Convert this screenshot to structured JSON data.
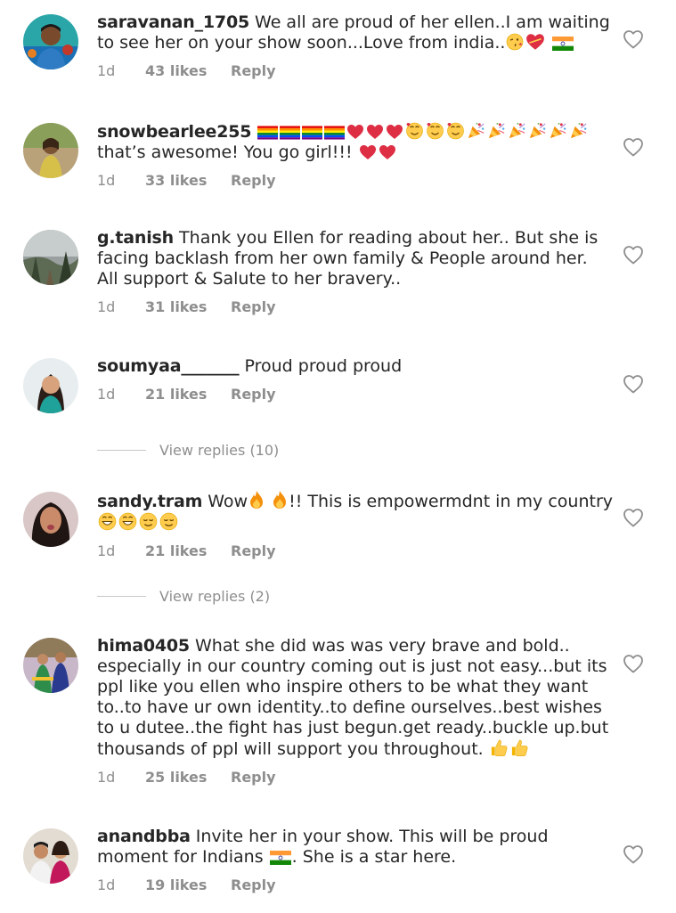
{
  "comments": [
    {
      "username": "saravanan_1705",
      "text_before": "We all are proud of her ellen..I am waiting to see her on your show soon...Love from india..",
      "emojis": [
        "kiss-face",
        "heart-ribbon",
        "india-flag"
      ],
      "time": "1d",
      "likes": "43 likes",
      "reply": "Reply"
    },
    {
      "username": "snowbearlee255",
      "head_emojis": [
        "rainbow-flag",
        "rainbow-flag",
        "rainbow-flag",
        "rainbow-flag",
        "red-heart",
        "red-heart",
        "red-heart",
        "smiling-face-with-hearts",
        "smiling-face-with-hearts",
        "smiling-face-with-hearts",
        "party-popper",
        "party-popper",
        "party-popper",
        "party-popper",
        "party-popper",
        "party-popper"
      ],
      "text": "that’s awesome! You go girl!!!",
      "tail_emojis": [
        "red-heart",
        "red-heart"
      ],
      "time": "1d",
      "likes": "33 likes",
      "reply": "Reply"
    },
    {
      "username": "g.tanish",
      "text": "Thank you Ellen for reading about her.. But she is facing backlash from her own family & People around her.  All support & Salute to her bravery..",
      "time": "1d",
      "likes": "31 likes",
      "reply": "Reply"
    },
    {
      "username": "soumyaa_______",
      "text": "Proud proud proud",
      "time": "1d",
      "likes": "21 likes",
      "reply": "Reply",
      "view_replies": "View replies (10)"
    },
    {
      "username": "sandy.tram",
      "text_a": "Wow",
      "text_b": "!! This is empowermdnt in my country",
      "emojis_a": [
        "fire",
        "fire"
      ],
      "emojis_b": [
        "grinning-face",
        "grinning-face",
        "relieved-face",
        "relieved-face"
      ],
      "time": "1d",
      "likes": "21 likes",
      "reply": "Reply",
      "view_replies": "View replies (2)"
    },
    {
      "username": "hima0405",
      "text": "What she did was was very brave and bold.. especially in our country coming out is just not easy...but its ppl like you ellen who inspire others to be what they want to..to have ur own identity..to define ourselves..best wishes to u dutee..the fight has just begun.get ready..buckle up.but thousands of ppl will support you throughout.",
      "emojis": [
        "thumbs-up",
        "thumbs-up"
      ],
      "time": "1d",
      "likes": "25 likes",
      "reply": "Reply"
    },
    {
      "username": "anandbba",
      "text_a": "Invite her in your show. This will be proud moment for Indians",
      "text_b": ". She is a star here.",
      "emojis": [
        "india-flag"
      ],
      "time": "1d",
      "likes": "19 likes",
      "reply": "Reply"
    }
  ],
  "colors": {
    "text": "#262626",
    "meta": "#8e8e8e",
    "divider": "#c7c7c7",
    "heart_outline": "#8e8e8e"
  }
}
